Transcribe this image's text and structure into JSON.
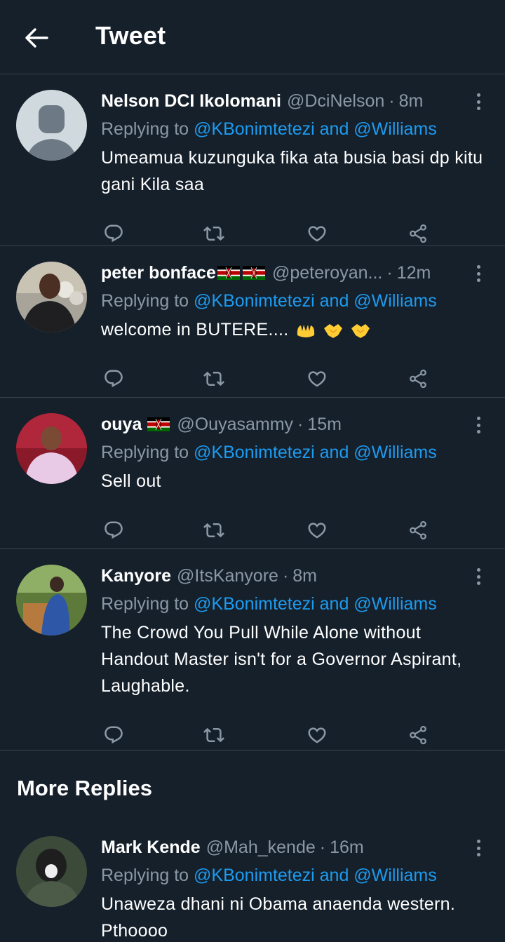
{
  "header": {
    "title": "Tweet"
  },
  "tweets": [
    {
      "name": "Nelson DCI Ikolomani",
      "handle": "@DciNelson",
      "time": "8m",
      "replying_prefix": "Replying to",
      "replying_to": "@KBonimtetezi and @Williams",
      "text": "Umeamua kuzunguka fika ata busia basi dp kitu gani Kila saa"
    },
    {
      "name": "peter bonface",
      "handle": "@peteroyan...",
      "time": "12m",
      "replying_prefix": "Replying to",
      "replying_to": "@KBonimtetezi and @Williams",
      "text": "welcome in BUTERE...."
    },
    {
      "name": "ouya",
      "handle": "@Ouyasammy",
      "time": "15m",
      "replying_prefix": "Replying to",
      "replying_to": "@KBonimtetezi and @Williams",
      "text": "Sell out"
    },
    {
      "name": "Kanyore",
      "handle": "@ItsKanyore",
      "time": "8m",
      "replying_prefix": "Replying to",
      "replying_to": "@KBonimtetezi and @Williams",
      "text": "The Crowd You Pull While Alone without Handout Master isn't for a Governor Aspirant, Laughable."
    }
  ],
  "more_replies": {
    "title": "More Replies",
    "tweet": {
      "name": "Mark Kende",
      "handle": "@Mah_kende",
      "time": "16m",
      "replying_prefix": "Replying to",
      "replying_to": "@KBonimtetezi and @Williams",
      "text": "Unaweza dhani ni Obama anaenda western. Pthoooo"
    }
  },
  "separator": "·",
  "icons": [
    "back-arrow-icon",
    "more-icon",
    "reply-icon",
    "retweet-icon",
    "like-icon",
    "share-icon",
    "kenya-flag-icon",
    "raising-hands-icon",
    "handshake-icon"
  ],
  "colors": {
    "background": "#15202b",
    "link": "#1d9bf0",
    "muted": "#8b98a5",
    "divider": "#38444d"
  }
}
